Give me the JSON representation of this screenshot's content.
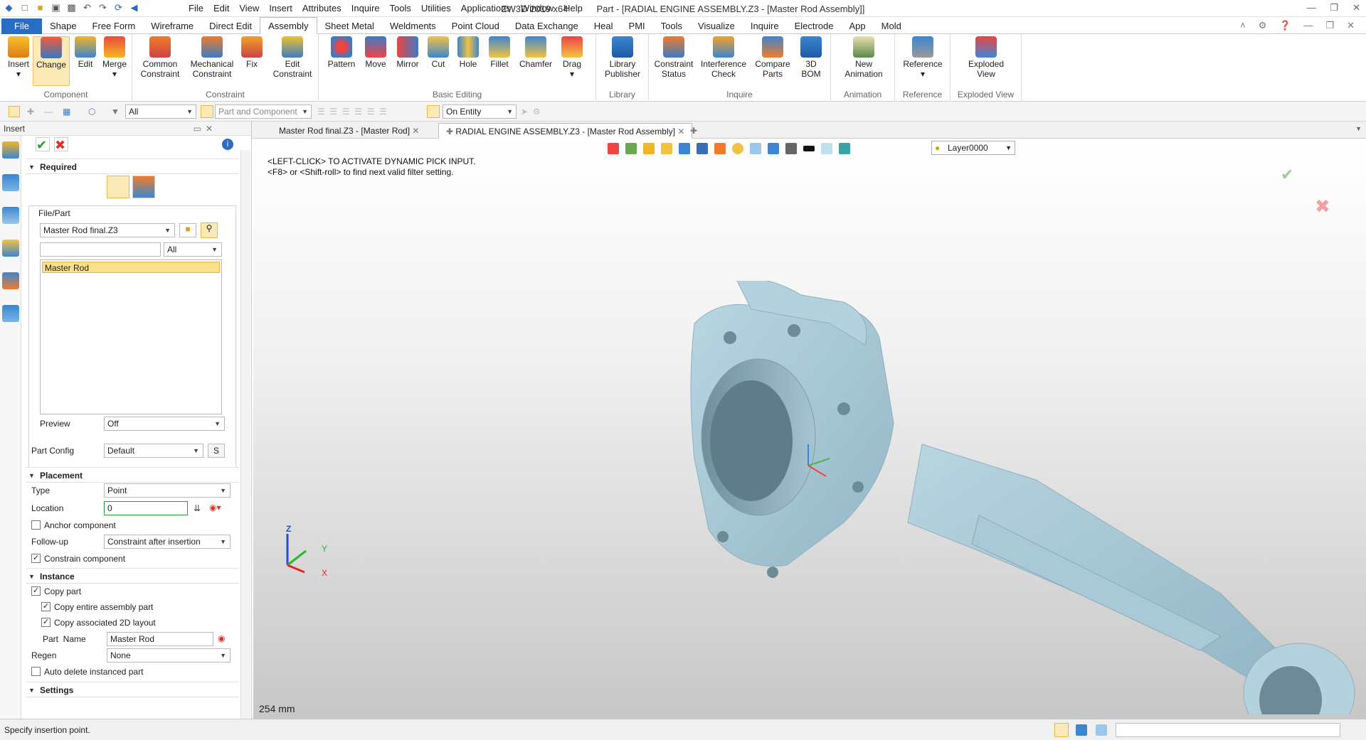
{
  "window": {
    "title": "ZW3D 2019  x64",
    "doc_title": "Part - [RADIAL ENGINE ASSEMBLY.Z3 - [Master Rod Assembly]]"
  },
  "menu": [
    "File",
    "Edit",
    "View",
    "Insert",
    "Attributes",
    "Inquire",
    "Tools",
    "Utilities",
    "Applications",
    "Window",
    "Help"
  ],
  "ribbon_tabs": [
    "File",
    "Shape",
    "Free Form",
    "Wireframe",
    "Direct Edit",
    "Assembly",
    "Sheet Metal",
    "Weldments",
    "Point Cloud",
    "Data Exchange",
    "Heal",
    "PMI",
    "Tools",
    "Visualize",
    "Inquire",
    "Electrode",
    "App",
    "Mold"
  ],
  "ribbon_groups": {
    "component": {
      "label": "Component",
      "buttons": [
        "Insert",
        "Change",
        "Edit",
        "Merge"
      ]
    },
    "constraint": {
      "label": "Constraint",
      "buttons": [
        "Common Constraint",
        "Mechanical Constraint",
        "Fix",
        "Edit Constraint"
      ]
    },
    "basic_editing": {
      "label": "Basic Editing",
      "buttons": [
        "Pattern",
        "Move",
        "Mirror",
        "Cut",
        "Hole",
        "Fillet",
        "Chamfer",
        "Drag"
      ]
    },
    "library": {
      "label": "Library",
      "buttons": [
        "Library Publisher"
      ]
    },
    "inquire": {
      "label": "Inquire",
      "buttons": [
        "Constraint Status",
        "Interference Check",
        "Compare Parts",
        "3D BOM"
      ]
    },
    "animation": {
      "label": "Animation",
      "buttons": [
        "New Animation"
      ]
    },
    "reference": {
      "label": "Reference",
      "buttons": [
        "Reference"
      ]
    },
    "exploded": {
      "label": "Exploded View",
      "buttons": [
        "Exploded View"
      ]
    }
  },
  "toolbar": {
    "filter_all": "All",
    "filter_part": "Part and Component",
    "pick_mode": "On Entity"
  },
  "panel": {
    "title": "Insert",
    "required": "Required",
    "file_part_label": "File/Part",
    "file_value": "Master Rod final.Z3",
    "search_value": "",
    "filter_value": "All",
    "list_item": "Master Rod",
    "preview_label": "Preview",
    "preview_value": "Off",
    "part_config_label": "Part Config",
    "part_config_value": "Default",
    "part_config_btn": "S",
    "placement": "Placement",
    "type_label": "Type",
    "type_value": "Point",
    "location_label": "Location",
    "location_value": "0",
    "anchor_label": "Anchor component",
    "followup_label": "Follow-up",
    "followup_value": "Constraint after insertion",
    "constrain_label": "Constrain component",
    "instance": "Instance",
    "copy_part": "Copy part",
    "copy_entire": "Copy entire assembly part",
    "copy_2d": "Copy associated 2D layout",
    "part_name_label": "Part  Name",
    "part_name_value": "Master Rod",
    "regen_label": "Regen",
    "regen_value": "None",
    "auto_delete": "Auto delete instanced part",
    "settings": "Settings"
  },
  "doc_tabs": [
    "Master Rod final.Z3 - [Master Rod]",
    "RADIAL ENGINE ASSEMBLY.Z3 - [Master Rod Assembly]"
  ],
  "viewport": {
    "msg1": "<LEFT-CLICK> TO ACTIVATE DYNAMIC PICK INPUT.",
    "msg2": "<F8> or <Shift-roll> to find next valid filter setting.",
    "layer": "Layer0000",
    "scale": "254 mm",
    "axis_x": "X",
    "axis_y": "Y",
    "axis_z": "Z"
  },
  "status": {
    "text": "Specify insertion point."
  },
  "colors": {
    "accent": "#2b6cc4",
    "part": "#a9c9d6",
    "selected": "#fbe9b7"
  }
}
